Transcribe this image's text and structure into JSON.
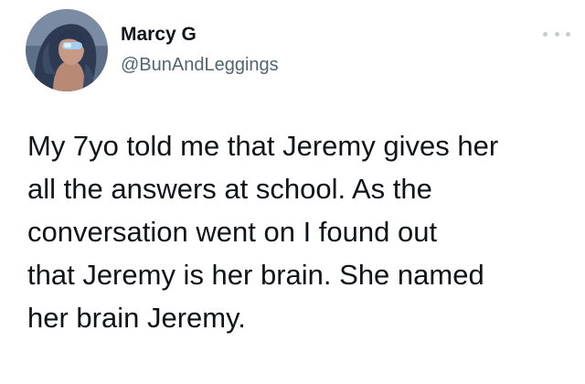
{
  "tweet": {
    "author": {
      "display_name": "Marcy G",
      "handle": "@BunAndLeggings",
      "avatar_icon": "profile-photo"
    },
    "more_icon": "ellipsis-icon",
    "text": "My 7yo told me that Jeremy gives her\nall the answers at school. As the\nconversation went on I found out\nthat Jeremy is her brain. She named\nher brain Jeremy."
  },
  "colors": {
    "background": "#ffffff",
    "text_primary": "#0f1419",
    "text_secondary": "#536471",
    "more_dots": "#c4ccd2"
  }
}
